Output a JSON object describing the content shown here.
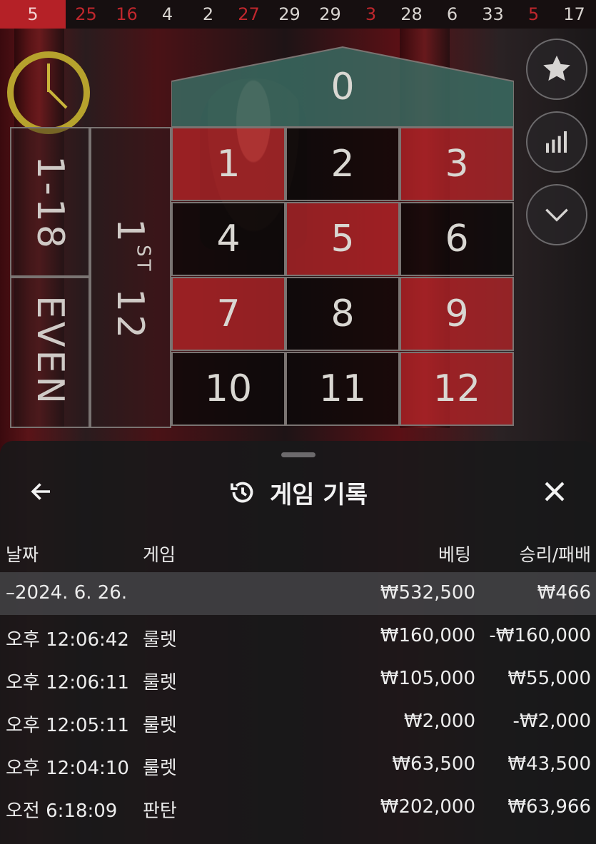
{
  "history": {
    "numbers": [
      {
        "n": "5",
        "color": "red",
        "latest": true
      },
      {
        "n": "25",
        "color": "red"
      },
      {
        "n": "16",
        "color": "red"
      },
      {
        "n": "4",
        "color": "black"
      },
      {
        "n": "2",
        "color": "black"
      },
      {
        "n": "27",
        "color": "red"
      },
      {
        "n": "29",
        "color": "black"
      },
      {
        "n": "29",
        "color": "black"
      },
      {
        "n": "3",
        "color": "red"
      },
      {
        "n": "28",
        "color": "black"
      },
      {
        "n": "6",
        "color": "black"
      },
      {
        "n": "33",
        "color": "black"
      },
      {
        "n": "5",
        "color": "red"
      },
      {
        "n": "17",
        "color": "black"
      }
    ]
  },
  "board": {
    "zero": "0",
    "cells": [
      {
        "n": "1",
        "color": "red"
      },
      {
        "n": "2",
        "color": "black"
      },
      {
        "n": "3",
        "color": "red"
      },
      {
        "n": "4",
        "color": "black"
      },
      {
        "n": "5",
        "color": "red"
      },
      {
        "n": "6",
        "color": "black"
      },
      {
        "n": "7",
        "color": "red"
      },
      {
        "n": "8",
        "color": "black"
      },
      {
        "n": "9",
        "color": "red"
      },
      {
        "n": "10",
        "color": "black"
      },
      {
        "n": "11",
        "color": "black"
      },
      {
        "n": "12",
        "color": "red"
      }
    ],
    "low_label": "1-18",
    "even_label": "EVEN",
    "dozen_label": "1",
    "dozen_suffix": "ST",
    "dozen_num": "12"
  },
  "controls": [
    "star-icon",
    "stats-icon",
    "chevron-down-icon"
  ],
  "colors": {
    "red": "#b52127",
    "green": "#3a6b62",
    "gold": "#b6a22d"
  },
  "sheet": {
    "title": "게임 기록",
    "columns": {
      "date": "날짜",
      "game": "게임",
      "bet": "베팅",
      "result": "승리/패배"
    },
    "summary": {
      "date": "–2024. 6. 26.",
      "bet": "₩532,500",
      "result": "₩466"
    },
    "rows": [
      {
        "time": "오후 12:06:42",
        "game": "룰렛",
        "bet": "₩160,000",
        "result": "-₩160,000"
      },
      {
        "time": "오후 12:06:11",
        "game": "룰렛",
        "bet": "₩105,000",
        "result": "₩55,000"
      },
      {
        "time": "오후 12:05:11",
        "game": "룰렛",
        "bet": "₩2,000",
        "result": "-₩2,000"
      },
      {
        "time": "오후 12:04:10",
        "game": "룰렛",
        "bet": "₩63,500",
        "result": "₩43,500"
      },
      {
        "time": "오전 6:18:09",
        "game": "판탄",
        "bet": "₩202,000",
        "result": "₩63,966"
      }
    ]
  }
}
